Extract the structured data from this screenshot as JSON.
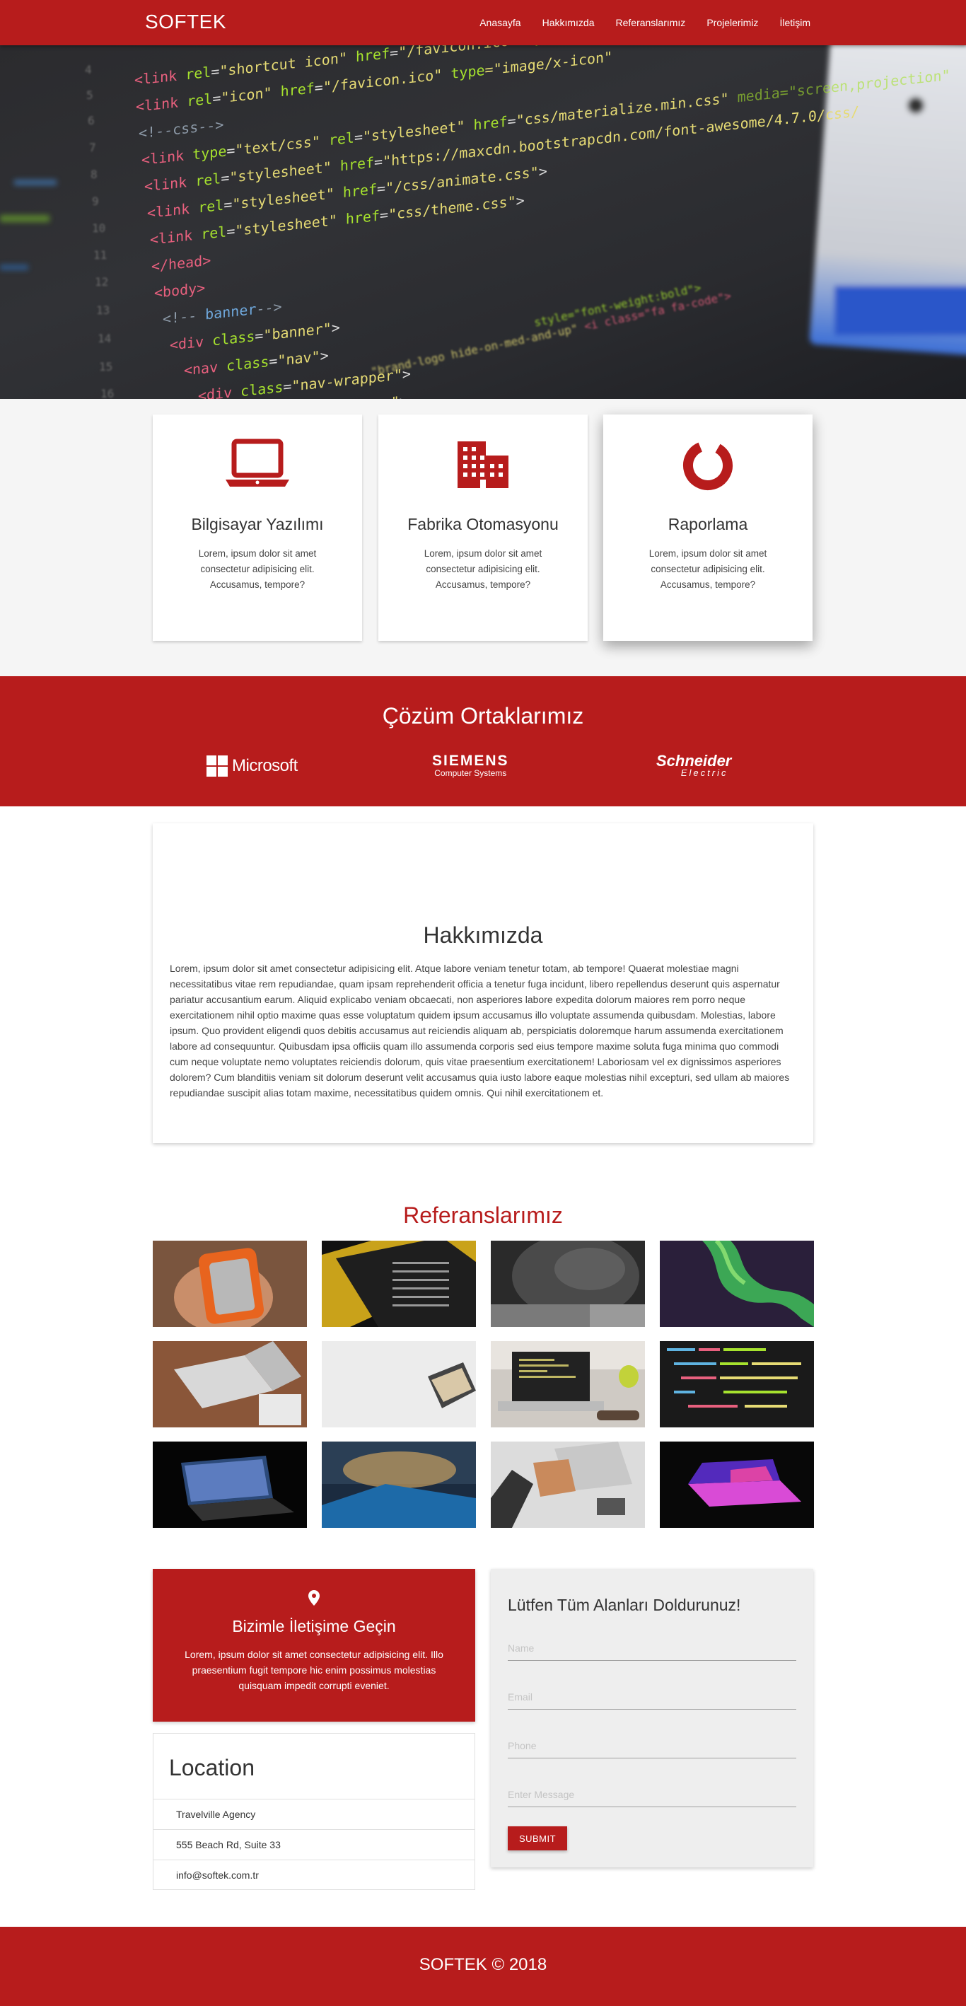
{
  "nav": {
    "brand": "SOFTEK",
    "links": [
      "Anasayfa",
      "Hakkımızda",
      "Referanslarımız",
      "Projelerimiz",
      "İletişim"
    ]
  },
  "hero": {
    "code_lines": [
      "<link rel=\"shortcut icon\" href=\"/favicon.ico\" type=\"image/x-icon\">",
      "<link rel=\"icon\" href=\"/favicon.ico\" type=\"image/x-icon\">",
      "<!--css-->",
      "<link type=\"text/css\" rel=\"stylesheet\" href=\"css/materialize.min.css\" media=\"screen,projection\">",
      "<link rel=\"stylesheet\" href=\"https://maxcdn.bootstrapcdn.com/font-awesome/4.7.0/css/font-awesome.min.css\">",
      "<link rel=\"stylesheet\" href=\"/css/animate.css\">",
      "<link rel=\"stylesheet\" href=\"css/theme.css\">",
      "</head>",
      "<body>",
      "<!-- banner-->",
      "<div class=\"banner\">",
      "<nav class=\"nav\">",
      "<div class=\"nav-wrapper\">",
      "<div class=\"container\">",
      "<a href=\"#\" class=\"brand-logo hide-on-med-and-up\">"
    ]
  },
  "services": [
    {
      "icon": "laptop-icon",
      "title": "Bilgisayar Yazılımı",
      "text": "Lorem, ipsum dolor sit amet consectetur adipisicing elit. Accusamus, tempore?"
    },
    {
      "icon": "factory-icon",
      "title": "Fabrika Otomasyonu",
      "text": "Lorem, ipsum dolor sit amet consectetur adipisicing elit. Accusamus, tempore?"
    },
    {
      "icon": "donut-chart-icon",
      "title": "Raporlama",
      "text": "Lorem, ipsum dolor sit amet consectetur adipisicing elit. Accusamus, tempore?"
    }
  ],
  "partners": {
    "title": "Çözüm Ortaklarımız",
    "logos": [
      {
        "name": "Microsoft"
      },
      {
        "name": "SIEMENS",
        "sub": "Computer Systems"
      },
      {
        "name": "Schneider",
        "sub": "Electric"
      }
    ]
  },
  "about": {
    "title": "Hakkımızda",
    "text": "Lorem, ipsum dolor sit amet consectetur adipisicing elit. Atque labore veniam tenetur totam, ab tempore! Quaerat molestiae magni necessitatibus vitae rem repudiandae, quam ipsam reprehenderit officia a tenetur fuga incidunt, libero repellendus deserunt quis aspernatur pariatur accusantium earum. Aliquid explicabo veniam obcaecati, non asperiores labore expedita dolorum maiores rem porro neque exercitationem nihil optio maxime quas esse voluptatum quidem ipsum accusamus illo voluptate assumenda quibusdam. Molestias, labore ipsum. Quo provident eligendi quos debitis accusamus aut reiciendis aliquam ab, perspiciatis doloremque harum assumenda exercitationem labore ad consequuntur. Quibusdam ipsa officiis quam illo assumenda corporis sed eius tempore maxime soluta fuga minima quo commodi cum neque voluptate nemo voluptates reiciendis dolorum, quis vitae praesentium exercitationem! Laboriosam vel ex dignissimos asperiores dolorem? Cum blanditiis veniam sit dolorum deserunt velit accusamus quia iusto labore eaque molestias nihil excepturi, sed ullam ab maiores repudiandae suscipit alias totam maxime, necessitatibus quidem omnis. Qui nihil exercitationem et."
  },
  "references": {
    "title": "Referanslarımız",
    "images": [
      "hard-drive-in-hand",
      "laptop-with-spreadsheet",
      "person-in-hoodie-with-laptop",
      "green-aurora",
      "laptop-on-wooden-desk",
      "laptop-on-white-table",
      "laptop-with-code-on-desk",
      "code-on-dark-screen",
      "laptop-glowing-in-dark",
      "blurred-landscape",
      "desk-top-view-with-laptop",
      "laptop-with-neon-lights"
    ]
  },
  "contact": {
    "title": "Bizimle İletişime Geçin",
    "text": "Lorem, ipsum dolor sit amet consectetur adipisicing elit. Illo praesentium fugit tempore hic enim possimus molestias quisquam impedit corrupti eveniet.",
    "location_title": "Location",
    "location_rows": [
      "Travelville Agency",
      "555 Beach Rd, Suite 33",
      "info@softek.com.tr"
    ]
  },
  "form": {
    "title": "Lütfen Tüm Alanları Doldurunuz!",
    "name_placeholder": "Name",
    "email_placeholder": "Email",
    "phone_placeholder": "Phone",
    "message_placeholder": "Enter Message",
    "submit_label": "Submit"
  },
  "footer": {
    "text": "SOFTEK © 2018"
  },
  "colors": {
    "accent": "#b71c1c",
    "light_bg": "#f5f5f5",
    "form_bg": "#eeeeee"
  }
}
